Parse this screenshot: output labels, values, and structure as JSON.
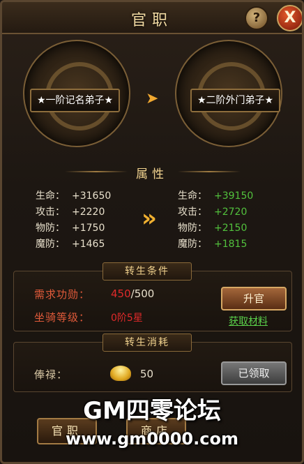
{
  "header": {
    "title": "官职"
  },
  "ranks": {
    "current": "★一阶记名弟子★",
    "next": "★二阶外门弟子★"
  },
  "attributes": {
    "title": "属性",
    "labels": [
      "生命：",
      "攻击：",
      "物防：",
      "魔防："
    ],
    "current": [
      "+31650",
      "+2220",
      "+1750",
      "+1465"
    ],
    "next": [
      "+39150",
      "+2720",
      "+2150",
      "+1815"
    ]
  },
  "conditions": {
    "title": "转生条件",
    "merit_label": "需求功勋：",
    "merit_current": "450",
    "merit_required": "/500",
    "mount_label": "坐骑等级：",
    "mount_value": "0阶5星",
    "upgrade_button": "升官",
    "get_materials_link": "获取材料"
  },
  "cost": {
    "title": "转生消耗",
    "salary_label": "俸禄：",
    "salary_value": "50",
    "claimed_button": "已领取"
  },
  "tabs": [
    "官职",
    "商店"
  ],
  "watermark": {
    "line1": "GM四零论坛",
    "line2": "www.gm0000.com"
  },
  "colors": {
    "gold": "#f1d28e",
    "green": "#52c13d",
    "red": "#e05a3a"
  }
}
